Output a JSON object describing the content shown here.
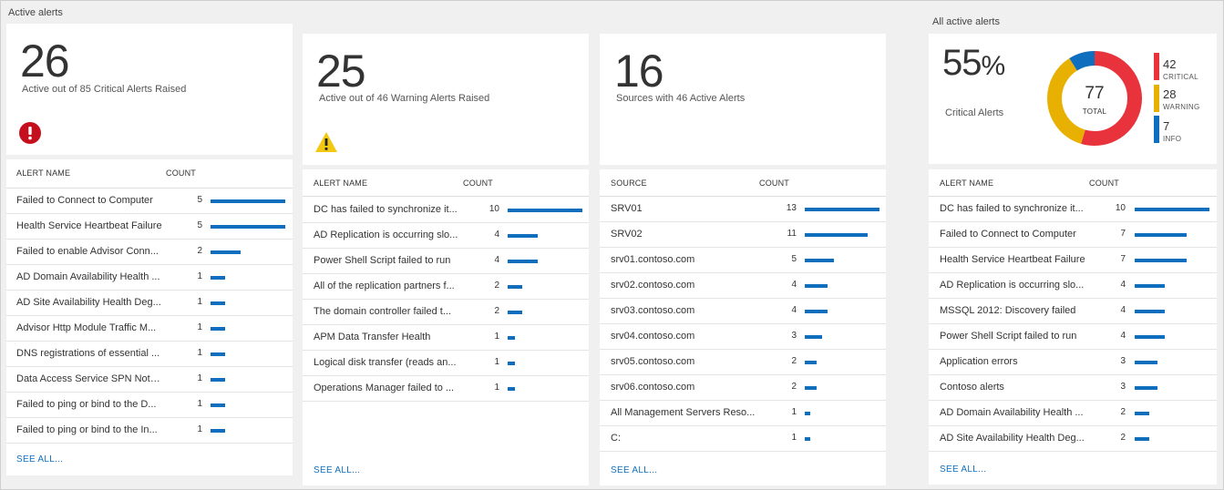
{
  "section_left": "Active alerts",
  "section_right": "All active alerts",
  "critical_tile": {
    "number": "26",
    "caption": "Active out of 85 Critical Alerts Raised",
    "icon": "error-circle-icon",
    "color": "#c50f1f"
  },
  "warning_tile": {
    "number": "25",
    "caption": "Active out of 46 Warning Alerts Raised",
    "icon": "warning-triangle-icon",
    "color": "#f2c811"
  },
  "sources_tile": {
    "number": "16",
    "caption": "Sources with 46 Active Alerts"
  },
  "all_tile": {
    "percent": "55",
    "percent_sign": "%",
    "caption": "Critical Alerts",
    "total_value": "77",
    "total_label": "TOTAL",
    "legend": [
      {
        "value": "42",
        "label": "CRITICAL",
        "count": 42,
        "color": "#e8323c"
      },
      {
        "value": "28",
        "label": "WARNING",
        "count": 28,
        "color": "#e8b000"
      },
      {
        "value": "7",
        "label": "INFO",
        "count": 7,
        "color": "#106ebe"
      }
    ]
  },
  "critical_list": {
    "col_name": "ALERT NAME",
    "col_count": "COUNT",
    "see_all": "SEE ALL...",
    "max": 5,
    "rows": [
      {
        "name": "Failed to Connect to Computer",
        "count": 5
      },
      {
        "name": "Health Service Heartbeat Failure",
        "count": 5
      },
      {
        "name": "Failed to enable Advisor Conn...",
        "count": 2
      },
      {
        "name": "AD Domain Availability Health ...",
        "count": 1
      },
      {
        "name": "AD Site Availability Health Deg...",
        "count": 1
      },
      {
        "name": "Advisor Http Module Traffic M...",
        "count": 1
      },
      {
        "name": "DNS registrations of essential ...",
        "count": 1
      },
      {
        "name": "Data Access Service SPN Not R...",
        "count": 1
      },
      {
        "name": "Failed to ping or bind to the D...",
        "count": 1
      },
      {
        "name": "Failed to ping or bind to the In...",
        "count": 1
      }
    ]
  },
  "warning_list": {
    "col_name": "ALERT NAME",
    "col_count": "COUNT",
    "see_all": "SEE ALL...",
    "max": 10,
    "rows": [
      {
        "name": "DC has failed to synchronize it...",
        "count": 10
      },
      {
        "name": "AD Replication is occurring slo...",
        "count": 4
      },
      {
        "name": "Power Shell Script failed to run",
        "count": 4
      },
      {
        "name": "All of the replication partners f...",
        "count": 2
      },
      {
        "name": "The domain controller failed t...",
        "count": 2
      },
      {
        "name": "APM Data Transfer Health",
        "count": 1
      },
      {
        "name": "Logical disk transfer (reads an...",
        "count": 1
      },
      {
        "name": "Operations Manager failed to ...",
        "count": 1
      }
    ]
  },
  "sources_list": {
    "col_name": "SOURCE",
    "col_count": "COUNT",
    "see_all": "SEE ALL...",
    "max": 13,
    "rows": [
      {
        "name": "SRV01",
        "count": 13
      },
      {
        "name": "SRV02",
        "count": 11
      },
      {
        "name": "srv01.contoso.com",
        "count": 5
      },
      {
        "name": "srv02.contoso.com",
        "count": 4
      },
      {
        "name": "srv03.contoso.com",
        "count": 4
      },
      {
        "name": "srv04.contoso.com",
        "count": 3
      },
      {
        "name": "srv05.contoso.com",
        "count": 2
      },
      {
        "name": "srv06.contoso.com",
        "count": 2
      },
      {
        "name": "All Management Servers Reso...",
        "count": 1
      },
      {
        "name": "C:",
        "count": 1
      }
    ]
  },
  "all_list": {
    "col_name": "ALERT NAME",
    "col_count": "COUNT",
    "see_all": "SEE ALL...",
    "max": 10,
    "rows": [
      {
        "name": "DC has failed to synchronize it...",
        "count": 10
      },
      {
        "name": "Failed to Connect to Computer",
        "count": 7
      },
      {
        "name": "Health Service Heartbeat Failure",
        "count": 7
      },
      {
        "name": "AD Replication is occurring slo...",
        "count": 4
      },
      {
        "name": "MSSQL 2012: Discovery failed",
        "count": 4
      },
      {
        "name": "Power Shell Script failed to run",
        "count": 4
      },
      {
        "name": "Application errors",
        "count": 3
      },
      {
        "name": "Contoso alerts",
        "count": 3
      },
      {
        "name": "AD Domain Availability Health ...",
        "count": 2
      },
      {
        "name": "AD Site Availability Health Deg...",
        "count": 2
      }
    ]
  }
}
